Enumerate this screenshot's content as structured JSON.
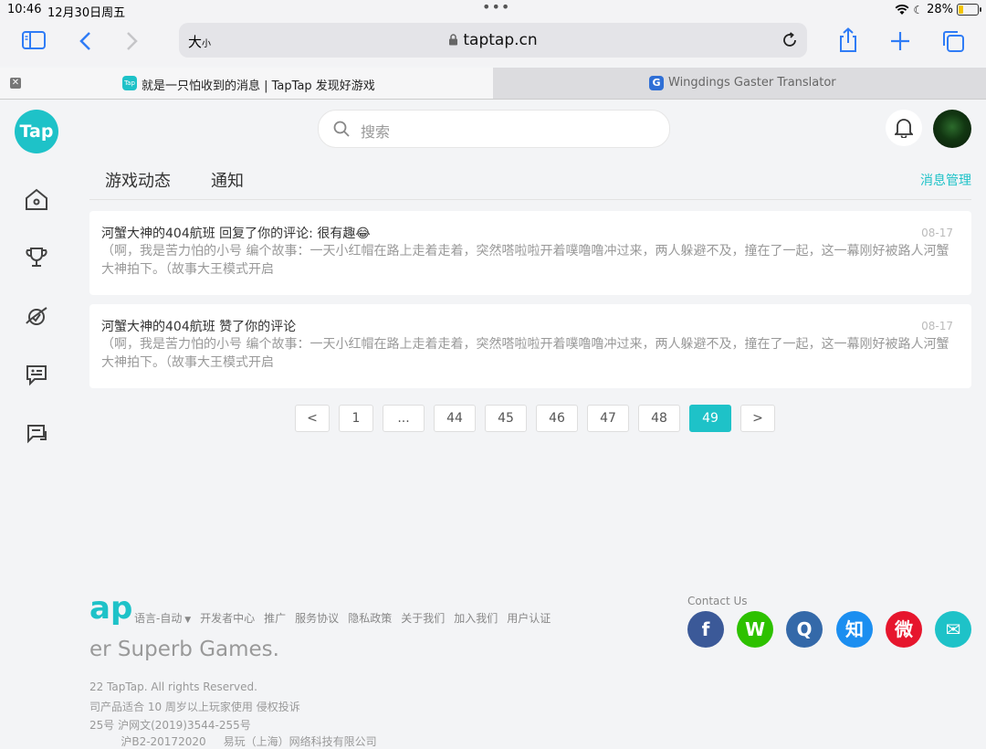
{
  "status": {
    "time": "10:46",
    "date": "12月30日周五",
    "battery": "28%",
    "battery_level": 0.28
  },
  "browser": {
    "text_size_big": "大",
    "text_size_small": "小",
    "url": "taptap.cn",
    "tabs": [
      {
        "title": "就是一只怕收到的消息 | TapTap 发现好游戏",
        "favicon": "Tap",
        "active": true
      },
      {
        "title": "Wingdings Gaster Translator",
        "favicon": "G",
        "active": false
      }
    ]
  },
  "sidebar": {
    "logo": "Tap"
  },
  "header": {
    "search_placeholder": "搜索"
  },
  "subtabs": {
    "game_news": "游戏动态",
    "notifications": "通知",
    "manage": "消息管理"
  },
  "messages": [
    {
      "title": "河蟹大神的404航班 回复了你的评论: 很有趣😂",
      "date": "08-17",
      "body": "（啊，我是苦力怕的小号 编个故事：一天小红帽在路上走着走着，突然嗒啦啦开着噗噜噜冲过来，两人躲避不及，撞在了一起，这一幕刚好被路人河蟹大神拍下。（故事大王模式开启"
    },
    {
      "title": "河蟹大神的404航班 赞了你的评论",
      "date": "08-17",
      "body": "（啊，我是苦力怕的小号 编个故事：一天小红帽在路上走着走着，突然嗒啦啦开着噗噜噜冲过来，两人躲避不及，撞在了一起，这一幕刚好被路人河蟹大神拍下。（故事大王模式开启"
    }
  ],
  "pagination": {
    "prev": "<",
    "next": ">",
    "pages": [
      "1",
      "...",
      "44",
      "45",
      "46",
      "47",
      "48",
      "49"
    ],
    "current": "49"
  },
  "footer": {
    "logo": "ap",
    "links": [
      "语言-自动",
      "开发者中心",
      "推广",
      "服务协议",
      "隐私政策",
      "关于我们",
      "加入我们",
      "用户认证"
    ],
    "slogan": "er Superb Games.",
    "copyright": "22 TapTap. All rights Reserved.",
    "age_notice": "司产品适合 10 周岁以上玩家使用 侵权投诉",
    "license": "25号   沪网文(2019)3544-255号",
    "company": "         沪B2-20172020     易玩（上海）网络科技有限公司",
    "contact_label": "Contact Us",
    "social": [
      {
        "glyph": "f",
        "color": "#3b5998"
      },
      {
        "glyph": "W",
        "color": "#2dc100"
      },
      {
        "glyph": "Q",
        "color": "#3469a9"
      },
      {
        "glyph": "知",
        "color": "#1b8ef0"
      },
      {
        "glyph": "微",
        "color": "#e6162d"
      },
      {
        "glyph": "✉",
        "color": "#1ec2c8"
      }
    ]
  }
}
